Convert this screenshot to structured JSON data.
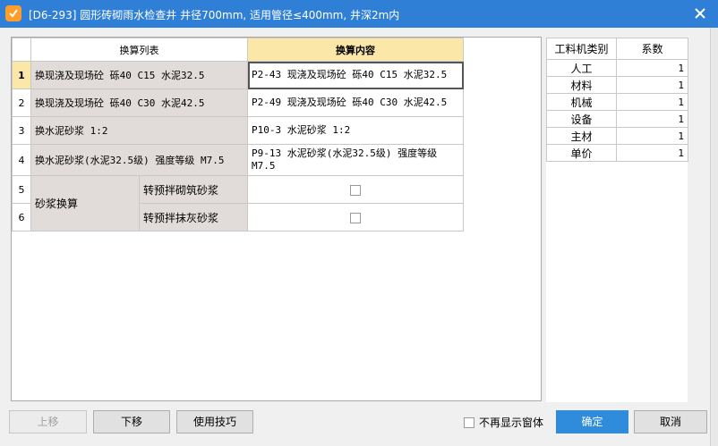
{
  "window": {
    "title": "[D6-293] 圆形砖砌雨水检查井 井径700mm, 适用管径≤400mm, 井深2m内"
  },
  "conversion_table": {
    "headers": {
      "list": "换算列表",
      "content": "换算内容"
    },
    "rows": [
      {
        "num": "1",
        "item": "换现浇及现场砼 砾40 C15 水泥32.5",
        "content": "P2-43  现浇及现场砼 砾40 C15 水泥32.5"
      },
      {
        "num": "2",
        "item": "换现浇及现场砼 砾40 C30 水泥42.5",
        "content": "P2-49  现浇及现场砼 砾40 C30 水泥42.5"
      },
      {
        "num": "3",
        "item": "换水泥砂浆 1:2",
        "content": "P10-3  水泥砂浆 1:2"
      },
      {
        "num": "4",
        "item": "换水泥砂浆(水泥32.5级) 强度等级 M7.5",
        "content": "P9-13  水泥砂浆(水泥32.5级) 强度等级 M7.5"
      }
    ],
    "mortar_group": {
      "label": "砂浆换算",
      "rows": [
        {
          "num": "5",
          "option": "转预拌砌筑砂浆",
          "checked": false
        },
        {
          "num": "6",
          "option": "转预拌抹灰砂浆",
          "checked": false
        }
      ]
    }
  },
  "coefficient_table": {
    "headers": {
      "category": "工料机类别",
      "coef": "系数"
    },
    "rows": [
      {
        "category": "人工",
        "value": "1"
      },
      {
        "category": "材料",
        "value": "1"
      },
      {
        "category": "机械",
        "value": "1"
      },
      {
        "category": "设备",
        "value": "1"
      },
      {
        "category": "主材",
        "value": "1"
      },
      {
        "category": "单价",
        "value": "1"
      }
    ]
  },
  "buttons": {
    "move_up": "上移",
    "move_down": "下移",
    "tips": "使用技巧",
    "no_show": "不再显示窗体",
    "ok": "确定",
    "cancel": "取消"
  },
  "colors": {
    "titlebar": "#2f7fd6",
    "header_highlight": "#fbe8a8",
    "item_cell": "#e1dcd9",
    "primary_button": "#2f8bdc"
  }
}
